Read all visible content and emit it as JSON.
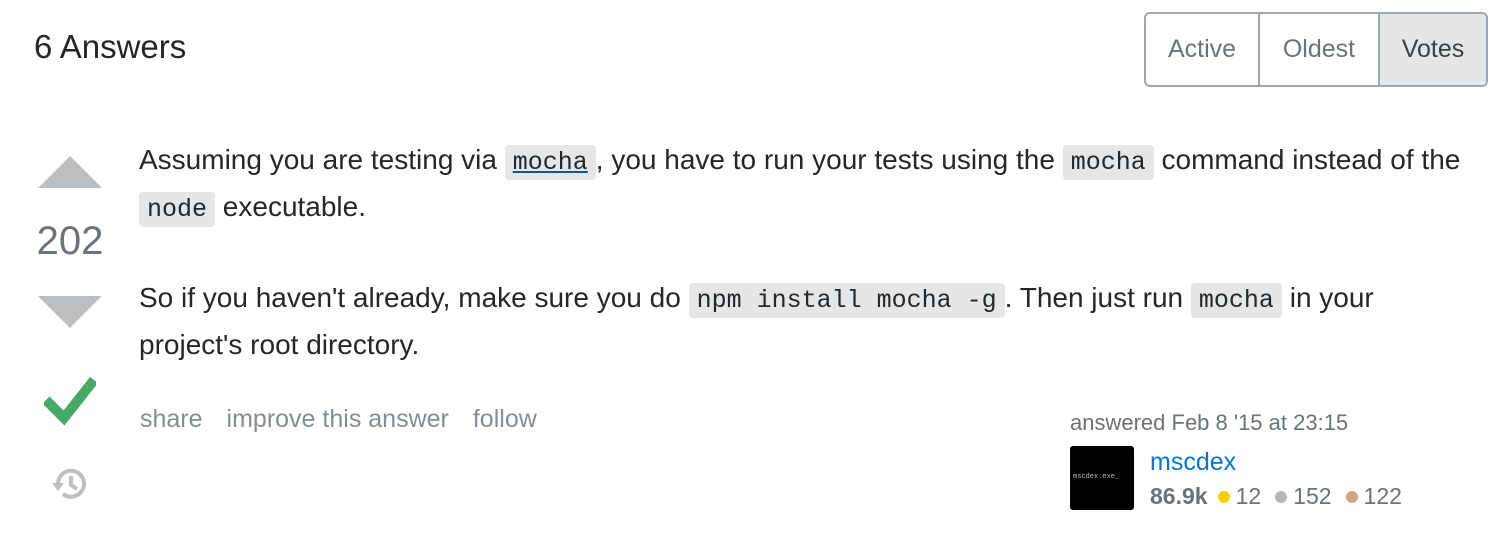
{
  "header": {
    "title": "6 Answers"
  },
  "sort": {
    "tabs": [
      {
        "label": "Active"
      },
      {
        "label": "Oldest"
      },
      {
        "label": "Votes"
      }
    ],
    "selected": "Votes"
  },
  "answer": {
    "score": "202",
    "accepted": true,
    "paragraph1": {
      "t1": "Assuming you are testing via ",
      "code1": "mocha",
      "t2": ", you have to run your tests using the ",
      "code2": "mocha",
      "t3": " command instead of the ",
      "code3": "node",
      "t4": " executable."
    },
    "paragraph2": {
      "t1": "So if you haven't already, make sure you do ",
      "code1": "npm install mocha -g",
      "t2": ". Then just run ",
      "code2": "mocha",
      "t3": " in your project's root directory."
    },
    "menu": {
      "share": "share",
      "improve": "improve this answer",
      "follow": "follow"
    },
    "signature": {
      "action": "answered Feb 8 '15 at 23:15",
      "avatar_text": "mscdex.exe_",
      "user_name": "mscdex",
      "reputation": "86.9k",
      "gold": "12",
      "silver": "152",
      "bronze": "122"
    }
  },
  "colors": {
    "link": "#0077cc",
    "accepted": "#48a868",
    "gold": "#ffcc01",
    "silver": "#b4b8bc",
    "bronze": "#d1a684"
  },
  "icons": {
    "accepted": "checkmark-icon",
    "history": "history-icon"
  }
}
